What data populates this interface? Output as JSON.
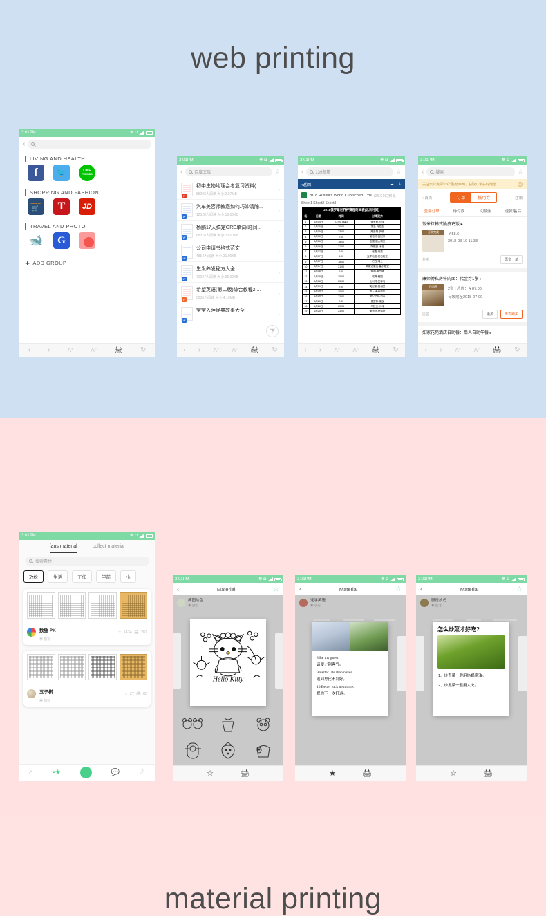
{
  "sections": {
    "web": {
      "title": "web printing",
      "bg": "#cfe0f2"
    },
    "material": {
      "title": "material printing",
      "bg": "#ffe1e1"
    }
  },
  "status": {
    "time": "3:01PM",
    "bluetooth": "bluetooth-icon",
    "wifi": "wifi-icon",
    "signal": "signal-icon",
    "battery": "battery-icon"
  },
  "browser_toolbar": {
    "back": "‹",
    "forward": "›",
    "font_increase": "A⁺",
    "font_decrease": "A⁻",
    "print": "print-icon",
    "reload": "↻"
  },
  "phone1": {
    "search_placeholder": "",
    "groups": [
      {
        "title": "LIVING AND HEALTH",
        "apps": [
          "Facebook",
          "Twitter",
          "LINE FRIENDS"
        ]
      },
      {
        "title": "SHOPPING AND FASHION",
        "apps": [
          "amazon",
          "T",
          "JD"
        ]
      },
      {
        "title": "TRAVEL AND PHOTO",
        "apps": [
          "Ctrip",
          "Google",
          "Photo"
        ]
      }
    ],
    "add_group": "ADD GROUP"
  },
  "phone2": {
    "url": "百度文库",
    "docs": [
      {
        "title": "初中生物地理会考复习资料(...",
        "meta": "55002人阅读  大小:2.07MB",
        "type": "pdf"
      },
      {
        "title": "汽车美容师教您如何巧妙清除...",
        "meta": "12528人阅读  大小:13.00KB",
        "type": "word"
      },
      {
        "title": "杨鹏17天搞定GRE单词(时间...",
        "meta": "68374人阅读  大小:70.00KB",
        "type": "word"
      },
      {
        "title": "公司申请书格式范文",
        "meta": "4854人阅读  大小:31.00KB",
        "type": "word"
      },
      {
        "title": "生发养发秘方大全",
        "meta": "70037人阅读  大小:36.00KB",
        "type": "word"
      },
      {
        "title": "希望英语(第二版)综合教程2 ...",
        "meta": "5236人阅读  大小:4.16MB",
        "type": "ppt"
      },
      {
        "title": "宝宝入睡经典故事大全",
        "meta": "",
        "type": "word"
      }
    ],
    "download_fab": "下"
  },
  "phone3": {
    "url": "139邮箱",
    "mail_back": "返回",
    "file_name": "2018 Russia's World Cup sched....xls",
    "file_size": "(26.01K)预览",
    "sheet_tabs": "Sheet1 Sheet2 Sheet3",
    "table": {
      "caption": "2018俄罗斯世界杯赛程时间表(北京时间)",
      "headers": [
        "场",
        "日期",
        "时间",
        "对阵双方"
      ],
      "rows": [
        [
          "1",
          "6月14日",
          "23:00(揭幕)",
          "俄罗斯-沙特"
        ],
        [
          "2",
          "6月15日",
          "20:00",
          "埃及-乌拉圭"
        ],
        [
          "3",
          "6月15日",
          "23:00",
          "摩洛哥-伊朗"
        ],
        [
          "4",
          "6月16日",
          "2:00",
          "葡萄牙-西班牙"
        ],
        [
          "5",
          "6月16日",
          "18:00",
          "法国-澳大利亚"
        ],
        [
          "6",
          "6月16日",
          "21:00",
          "阿根廷-冰岛"
        ],
        [
          "7",
          "6月17日",
          "0:00",
          "秘鲁-丹麦"
        ],
        [
          "8",
          "6月17日",
          "3:00",
          "克罗地亚-尼日利亚"
        ],
        [
          "9",
          "6月17日",
          "18:00",
          "巴西-瑞士"
        ],
        [
          "10",
          "6月17日",
          "21:00",
          "哥斯达黎加-塞尔维亚"
        ],
        [
          "11",
          "6月18日",
          "0:00",
          "德国-墨西哥"
        ],
        [
          "12",
          "6月18日",
          "20:00",
          "瑞典-韩国"
        ],
        [
          "13",
          "6月18日",
          "23:00",
          "比利时-巴拿马"
        ],
        [
          "14",
          "6月19日",
          "2:00",
          "突尼斯-英格兰"
        ],
        [
          "15",
          "6月19日",
          "20:00",
          "波兰-塞内加尔"
        ],
        [
          "16",
          "6月19日",
          "23:00",
          "哥伦比亚-日本"
        ],
        [
          "17",
          "6月20日",
          "2:00",
          "俄罗斯-埃及"
        ],
        [
          "18",
          "6月20日",
          "20:00",
          "乌拉圭-沙特"
        ],
        [
          "19",
          "6月20日",
          "23:00",
          "葡萄牙-摩洛哥"
        ]
      ]
    }
  },
  "phone4": {
    "url": "搜索",
    "notice": "关注大众点评公众号(dpsun)，获取订单实时动态",
    "home": "首页",
    "seg_on": "订单",
    "seg_off": "抵用券",
    "logout": "注销",
    "tabs": [
      "全部订单",
      "待付款",
      "可使用",
      "退款/售后"
    ],
    "orders": [
      {
        "title": "饭米粒韩式脆皮鸡饭 ▸",
        "badge": "订单完成",
        "price": "￥58.6",
        "date": "2018-03-19 11:33",
        "cat": "外卖",
        "buttons": [
          "再交一单"
        ]
      },
      {
        "title": "康师傅私房牛肉面：代金券1张 ▸",
        "badge": "已消费",
        "price": "2张 | 总价：￥87.00",
        "date": "有效期至2018-07-09",
        "cat": "匿名",
        "buttons": [
          "更多",
          "再次购买"
        ]
      }
    ],
    "next_order": "如家花苑酒店自助餐：单人自助午餐 ▸"
  },
  "phone5": {
    "tabs": [
      "fans material",
      "collect material"
    ],
    "search_placeholder": "搜索素材",
    "chips": [
      "放松",
      "生活",
      "工作",
      "学前",
      "小"
    ],
    "cards": [
      {
        "name": "数独 PK",
        "tag": "放松",
        "likes": "1434",
        "prints": "287"
      },
      {
        "name": "五子棋",
        "tag": "放松",
        "likes": "27",
        "prints": "65"
      }
    ],
    "nav": [
      "home-icon",
      "material-icon",
      "add-icon",
      "message-icon",
      "profile-icon"
    ]
  },
  "phone6": {
    "title": "Material",
    "author": "简图绘色",
    "author_tag": "放松",
    "art_text": "Hello Kitty",
    "footer": [
      "favorite-icon",
      "print-icon"
    ]
  },
  "phone7": {
    "title": "Material",
    "author": "逢学英语",
    "author_tag": "学前",
    "lines": [
      "8.Be my guest.",
      "请便／别客气。",
      "9.Better late than never.",
      "迟到总比不到好。",
      "10.Better luck next time.",
      "祝你下一次好运。"
    ],
    "footer": [
      "favorite-filled-icon",
      "print-icon"
    ]
  },
  "phone8": {
    "title": "Material",
    "author": "厨房技巧",
    "author_tag": "生活",
    "headline": "怎么炒菜才好吃?",
    "lines": [
      "1、炒青菜一般用热锅凉油。",
      "2、炒足菜一般用大火。"
    ],
    "footer": [
      "favorite-icon",
      "print-icon"
    ]
  }
}
